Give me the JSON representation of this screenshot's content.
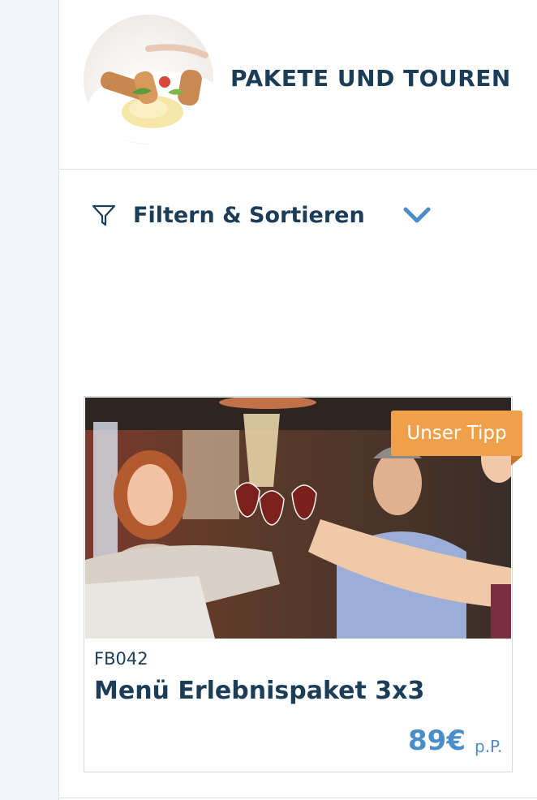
{
  "header": {
    "title": "PAKETE UND TOUREN",
    "avatar_icon": "food-plate-photo"
  },
  "filter": {
    "label": "Filtern & Sortieren",
    "icon": "funnel-icon",
    "toggle_icon": "chevron-down-icon"
  },
  "card": {
    "badge": "Unser Tipp",
    "code": "FB042",
    "title": "Menü Erlebnispaket 3x3",
    "price": "89€",
    "price_unit": "p.P.",
    "image": "people-toasting-wine-photo"
  },
  "colors": {
    "primary_text": "#1b3d57",
    "accent_blue": "#4a8ec9",
    "badge_orange": "#f0a04b",
    "rail_bg": "#f2f6fb",
    "border": "#d9e1ea"
  }
}
